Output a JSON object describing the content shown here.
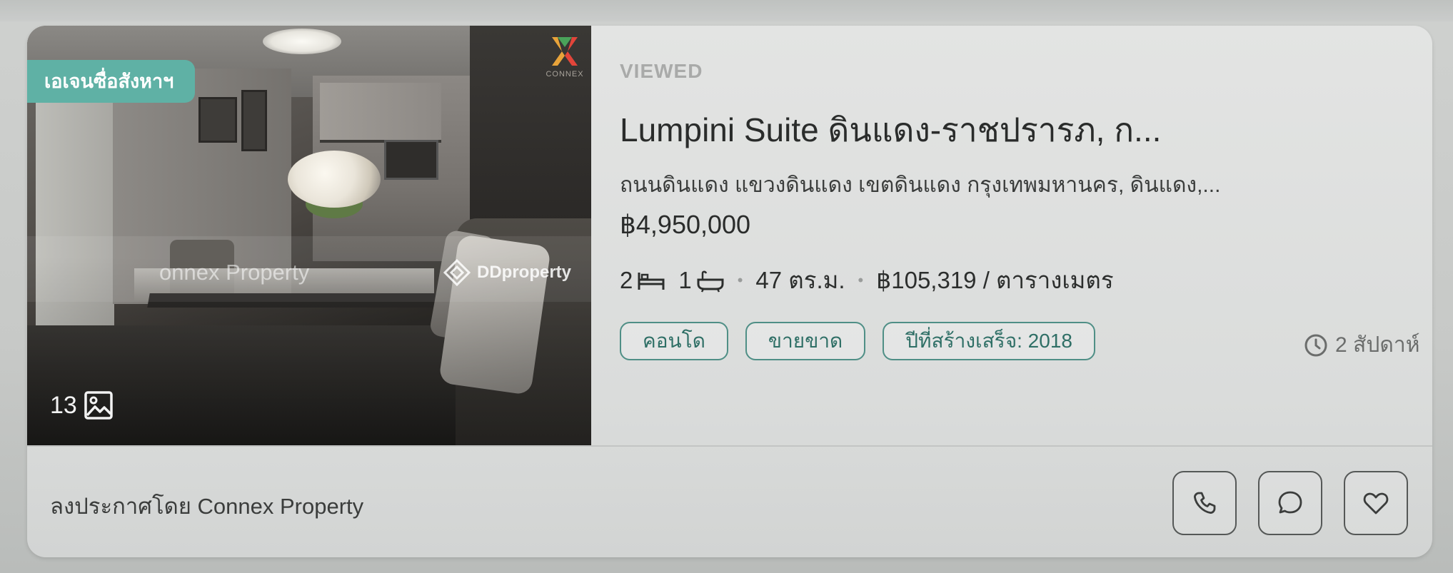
{
  "listing": {
    "badge": "เอเจนซื่อสังหาฯ",
    "photo_count": "13",
    "watermark_left": "onnex Property",
    "watermark_right": "DDproperty",
    "brand_logo_text": "CONNEX",
    "viewed_label": "VIEWED",
    "title": "Lumpini Suite ดินแดง-ราชปรารภ, ก...",
    "address": "ถนนดินแดง แขวงดินแดง เขตดินแดง กรุงเทพมหานคร, ดินแดง,...",
    "price": "฿4,950,000",
    "bedrooms": "2",
    "bathrooms": "1",
    "area": "47 ตร.ม.",
    "price_per_sqm": "฿105,319 / ตารางเมตร",
    "tags": [
      "คอนโด",
      "ขายขาด",
      "ปีที่สร้างเสร็จ: 2018"
    ],
    "posted_ago": "2 สัปดาห์",
    "listed_by": "ลงประกาศโดย Connex Property"
  },
  "icons": {
    "bed": "bed-icon",
    "bath": "bathtub-icon",
    "gallery": "image-icon",
    "clock": "clock-icon",
    "phone": "phone-icon",
    "chat": "chat-icon",
    "favorite": "heart-icon"
  },
  "colors": {
    "badge_bg": "#5fb1a5",
    "tag_border": "#4f8f86",
    "card_bg": "#e3e4e3"
  }
}
